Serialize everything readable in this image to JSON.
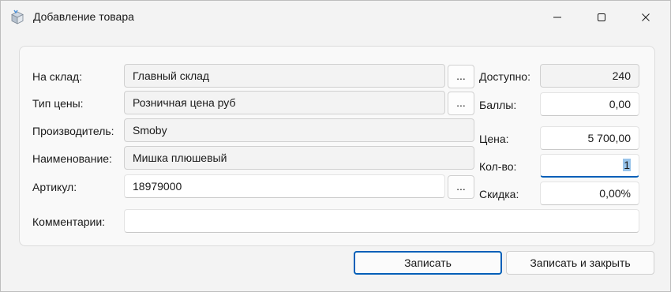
{
  "window": {
    "title": "Добавление товара",
    "icon": "box-icon"
  },
  "form": {
    "warehouse": {
      "label": "На склад:",
      "value": "Главный склад",
      "button": "..."
    },
    "price_type": {
      "label": "Тип цены:",
      "value": "Розничная цена руб",
      "button": "..."
    },
    "manufacturer": {
      "label": "Производитель:",
      "value": "Smoby"
    },
    "name": {
      "label": "Наименование:",
      "value": "Мишка плюшевый"
    },
    "article": {
      "label": "Артикул:",
      "value": "18979000",
      "button": "..."
    },
    "comment": {
      "label": "Комментарии:",
      "value": ""
    },
    "available": {
      "label": "Доступно:",
      "value": "240"
    },
    "points": {
      "label": "Баллы:",
      "value": "0,00"
    },
    "price": {
      "label": "Цена:",
      "value": "5 700,00"
    },
    "quantity": {
      "label": "Кол-во:",
      "value": "1"
    },
    "discount": {
      "label": "Скидка:",
      "value": "0,00%"
    }
  },
  "buttons": {
    "save": "Записать",
    "save_close": "Записать и закрыть"
  },
  "colors": {
    "accent": "#005fb8",
    "selection": "#99c4ea",
    "background": "#f3f3f3"
  }
}
